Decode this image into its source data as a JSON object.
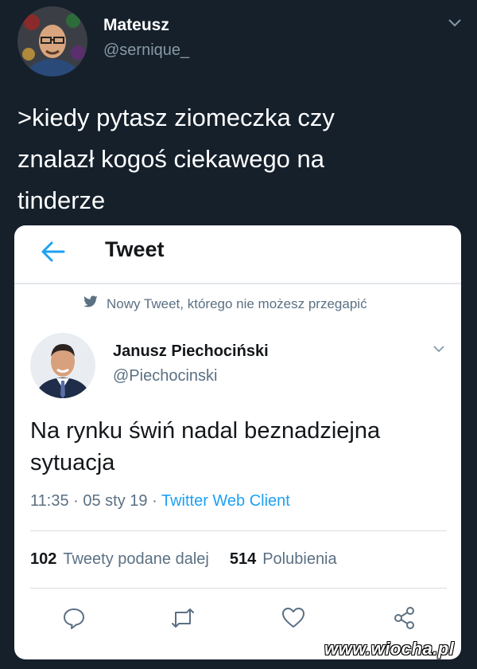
{
  "outer_tweet": {
    "author_name": "Mateusz",
    "author_handle": "@sernique_",
    "text_lines": [
      ">kiedy pytasz ziomeczka czy",
      "znalazł kogoś ciekawego na",
      "tinderze"
    ]
  },
  "embedded_tweet": {
    "header_title": "Tweet",
    "promoted_label": "Nowy Tweet, którego nie możesz przegapić",
    "author_name": "Janusz Piechociński",
    "author_handle": "@Piechocinski",
    "text_lines": [
      "Na rynku świń nadal beznadziejna",
      "sytuacja"
    ],
    "time": "11:35",
    "date": "05 sty 19",
    "client": "Twitter Web Client",
    "retweets_count": "102",
    "retweets_label": "Tweety podane dalej",
    "likes_count": "514",
    "likes_label": "Polubienia"
  },
  "watermark": "www.wiocha.pl",
  "icons": [
    "chevron-down-icon",
    "back-arrow-icon",
    "twitter-bird-icon",
    "reply-icon",
    "retweet-icon",
    "like-icon",
    "share-icon"
  ],
  "colors": {
    "background": "#15202b",
    "accent": "#1da1f2",
    "card": "#ffffff",
    "secondary_text": "#8899a6"
  }
}
